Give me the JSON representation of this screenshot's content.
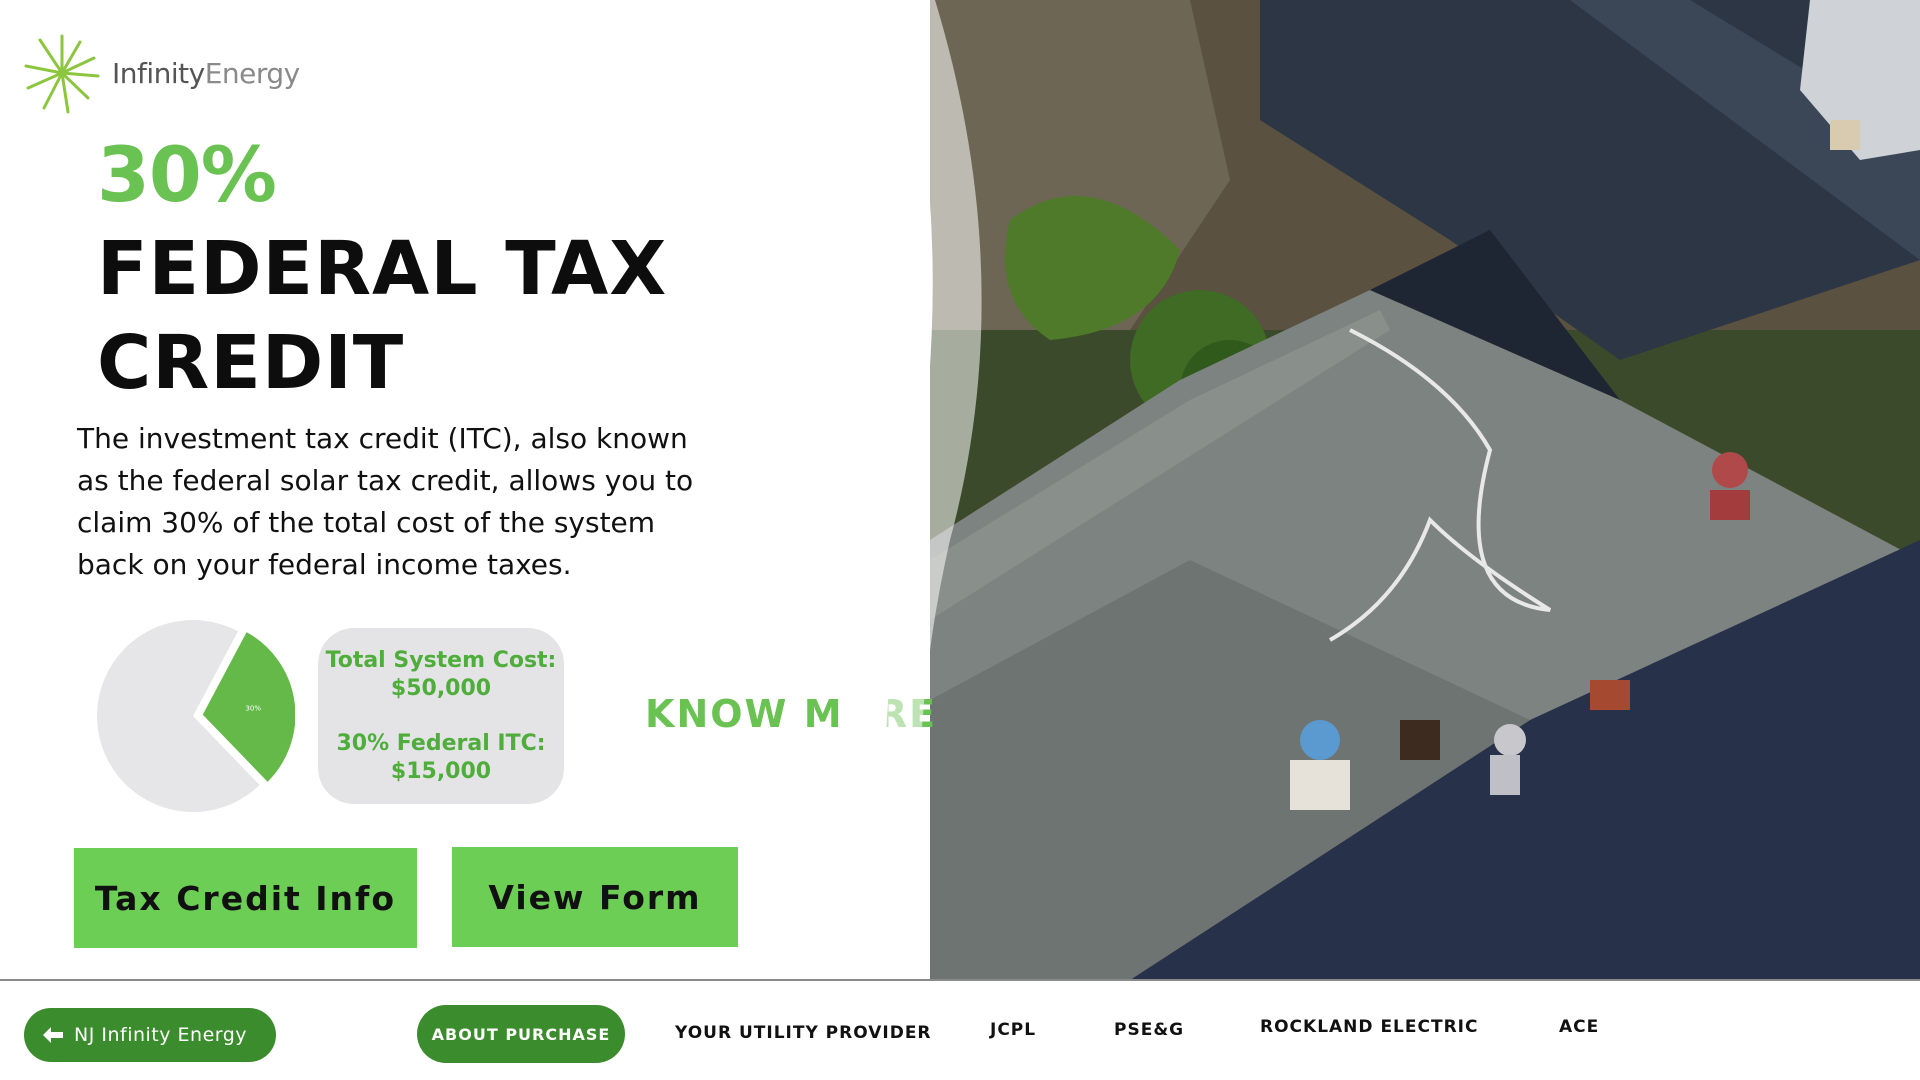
{
  "brand": {
    "name_part1": "Infinity",
    "name_part2": "Energy",
    "accent_color": "#6ac253",
    "dark_green": "#3b8c2c"
  },
  "hero": {
    "percent": "30%",
    "title_line1": "FEDERAL TAX",
    "title_line2": "CREDIT",
    "description": "The investment tax credit (ITC), also known as the federal solar tax credit, allows you to claim 30% of the total cost of the system back on your federal income taxes."
  },
  "chart_data": {
    "type": "pie",
    "slices": [
      {
        "label": "30%",
        "value": 30,
        "color": "#64b949"
      },
      {
        "label": "",
        "value": 70,
        "color": "#e6e6e8"
      }
    ]
  },
  "info_card": {
    "cost_label": "Total System Cost:",
    "cost_value": "$50,000",
    "itc_label": "30% Federal ITC:",
    "itc_value": "$15,000"
  },
  "know_more": "KNOW MORE",
  "buttons": {
    "tax_credit": "Tax Credit Info",
    "view_form": "View Form"
  },
  "nav": {
    "back": "NJ Infinity Energy",
    "active": "ABOUT PURCHASE",
    "links": [
      "YOUR UTILITY PROVIDER",
      "JCPL",
      "PSE&G",
      "ROCKLAND ELECTRIC",
      "ACE"
    ]
  },
  "icons": {
    "logo": "sunburst-logo-icon",
    "back": "arrow-left-icon"
  }
}
